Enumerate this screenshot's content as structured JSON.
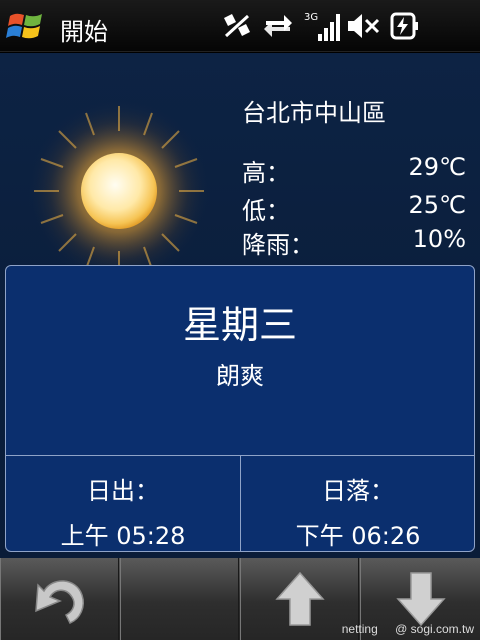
{
  "statusbar": {
    "title": "開始",
    "icons": [
      "windows-start-icon",
      "connectivity-icon",
      "sync-arrows-icon",
      "3g-signal-icon",
      "speaker-muted-icon",
      "battery-charging-icon"
    ],
    "network_label": "3G"
  },
  "weather": {
    "location": "台北市中山區",
    "icon": "sunny-icon",
    "high_label": "高：",
    "high_value": "29℃",
    "low_label": "低：",
    "low_value": "25℃",
    "rain_label": "降雨：",
    "rain_value": "10%"
  },
  "day": {
    "name": "星期三",
    "condition": "朗爽",
    "sunrise_label": "日出：",
    "sunrise_value": "上午 05:28",
    "sunset_label": "日落：",
    "sunset_value": "下午 06:26"
  },
  "toolbar": {
    "buttons": [
      "back-icon",
      "empty",
      "up-arrow-icon",
      "down-arrow-icon"
    ]
  },
  "watermark": {
    "left": "netting",
    "right": "@ sogi.com.tw"
  }
}
